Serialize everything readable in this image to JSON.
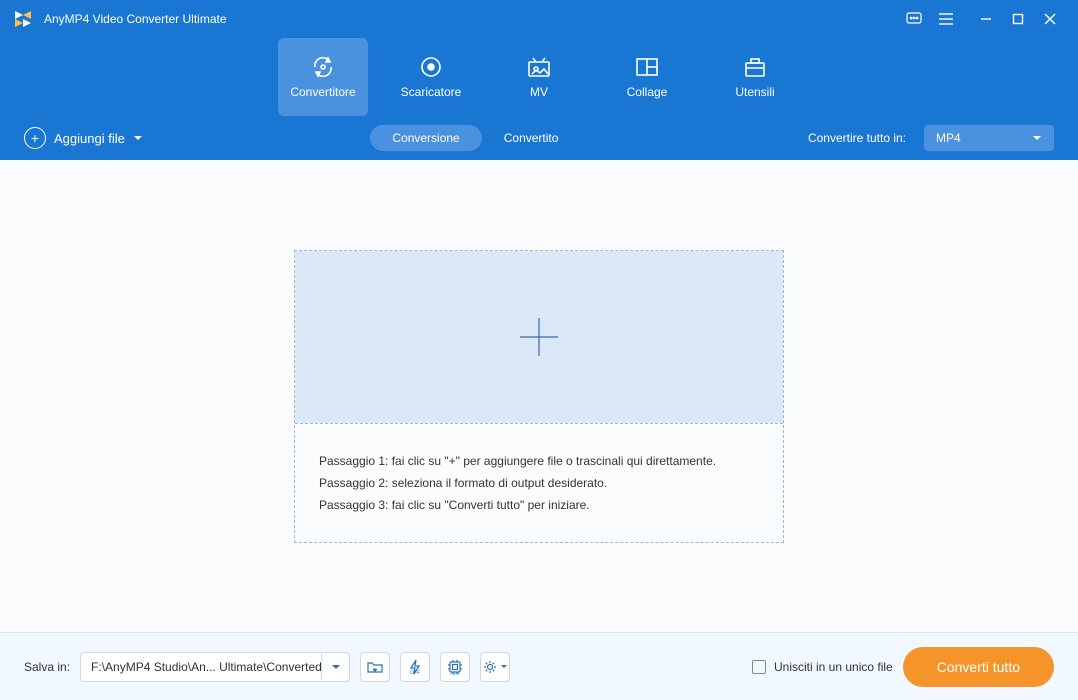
{
  "titlebar": {
    "title": "AnyMP4 Video Converter Ultimate"
  },
  "tabs": {
    "converter": "Convertitore",
    "downloader": "Scaricatore",
    "mv": "MV",
    "collage": "Collage",
    "tools": "Utensili"
  },
  "subbar": {
    "add_file": "Aggiungi file",
    "seg_conversion": "Conversione",
    "seg_converted": "Convertito",
    "convert_all_label": "Convertire tutto in:",
    "format": "MP4"
  },
  "dropzone": {
    "step1": "Passaggio 1: fai clic su \"+\" per aggiungere file o trascinali qui direttamente.",
    "step2": "Passaggio 2: seleziona il formato di output desiderato.",
    "step3": "Passaggio 3: fai clic su \"Converti tutto\" per iniziare."
  },
  "footer": {
    "save_label": "Salva in:",
    "path": "F:\\AnyMP4 Studio\\An... Ultimate\\Converted",
    "merge_label": "Unisciti in un unico file",
    "convert_btn": "Converti tutto"
  }
}
